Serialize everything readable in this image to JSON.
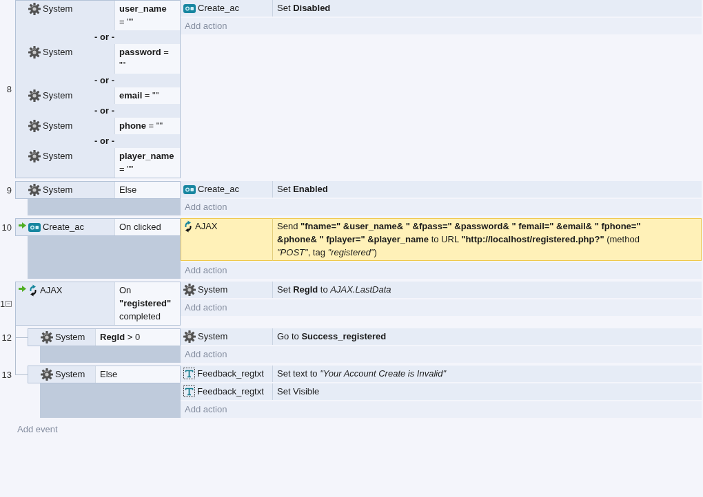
{
  "events": [
    {
      "number": "8",
      "conditions": [
        {
          "kind": "condition",
          "trigger": false,
          "object": {
            "kind": "system",
            "name": "System"
          },
          "text": "**user_name** = \"\""
        },
        {
          "kind": "separator",
          "text": "- or -"
        },
        {
          "kind": "condition",
          "trigger": false,
          "object": {
            "kind": "system",
            "name": "System"
          },
          "text": "**password** = \"\""
        },
        {
          "kind": "separator",
          "text": "- or -"
        },
        {
          "kind": "condition",
          "trigger": false,
          "object": {
            "kind": "system",
            "name": "System"
          },
          "text": "**email** = \"\""
        },
        {
          "kind": "separator",
          "text": "- or -"
        },
        {
          "kind": "condition",
          "trigger": false,
          "object": {
            "kind": "system",
            "name": "System"
          },
          "text": "**phone** = \"\""
        },
        {
          "kind": "separator",
          "text": "- or -"
        },
        {
          "kind": "condition",
          "trigger": false,
          "object": {
            "kind": "system",
            "name": "System"
          },
          "text": "**player_name** = \"\""
        }
      ],
      "actions": [
        {
          "selected": false,
          "object": {
            "kind": "button",
            "name": "Create_ac"
          },
          "text": "Set **Disabled**"
        }
      ],
      "add_action": "Add action"
    },
    {
      "number": "9",
      "conditions": [
        {
          "kind": "condition",
          "trigger": false,
          "object": {
            "kind": "system",
            "name": "System"
          },
          "text": "Else"
        }
      ],
      "actions": [
        {
          "selected": false,
          "object": {
            "kind": "button",
            "name": "Create_ac"
          },
          "text": "Set **Enabled**"
        }
      ],
      "add_action": "Add action"
    },
    {
      "number": "10",
      "conditions": [
        {
          "kind": "condition",
          "trigger": true,
          "object": {
            "kind": "button",
            "name": "Create_ac"
          },
          "text": "On clicked"
        }
      ],
      "actions": [
        {
          "selected": true,
          "object": {
            "kind": "ajax",
            "name": "AJAX"
          },
          "text": "Send **\"fname=\" &user_name& \" &fpass=\" &password& \" femail=\" &email& \" fphone=\" &phone& \" fplayer=\" &player_name** to URL **\"http://localhost/registered.php?\"** (method *\"POST\"*, tag *\"registered\"*)"
        }
      ],
      "add_action": "Add action"
    },
    {
      "number": "1",
      "expanded": true,
      "conditions": [
        {
          "kind": "condition",
          "trigger": true,
          "object": {
            "kind": "ajax",
            "name": "AJAX"
          },
          "text": "On **\"registered\"** completed"
        }
      ],
      "actions": [
        {
          "selected": false,
          "object": {
            "kind": "system",
            "name": "System"
          },
          "text": "Set **RegId** to *AJAX.LastData*"
        }
      ],
      "add_action": "Add action",
      "children": [
        {
          "number": "12",
          "conditions": [
            {
              "kind": "condition",
              "trigger": false,
              "object": {
                "kind": "system",
                "name": "System"
              },
              "text": "**RegId** > 0"
            }
          ],
          "actions": [
            {
              "selected": false,
              "object": {
                "kind": "system",
                "name": "System"
              },
              "text": "Go to **Success_registered**"
            }
          ],
          "add_action": "Add action"
        },
        {
          "number": "13",
          "conditions": [
            {
              "kind": "condition",
              "trigger": false,
              "object": {
                "kind": "system",
                "name": "System"
              },
              "text": "Else"
            }
          ],
          "actions": [
            {
              "selected": false,
              "object": {
                "kind": "text",
                "name": "Feedback_regtxt"
              },
              "text": "Set text to *\"Your Account Create is Invalid\"*"
            },
            {
              "selected": false,
              "object": {
                "kind": "text",
                "name": "Feedback_regtxt"
              },
              "text": "Set Visible"
            }
          ],
          "add_action": "Add action"
        }
      ]
    }
  ],
  "add_event": "Add event"
}
